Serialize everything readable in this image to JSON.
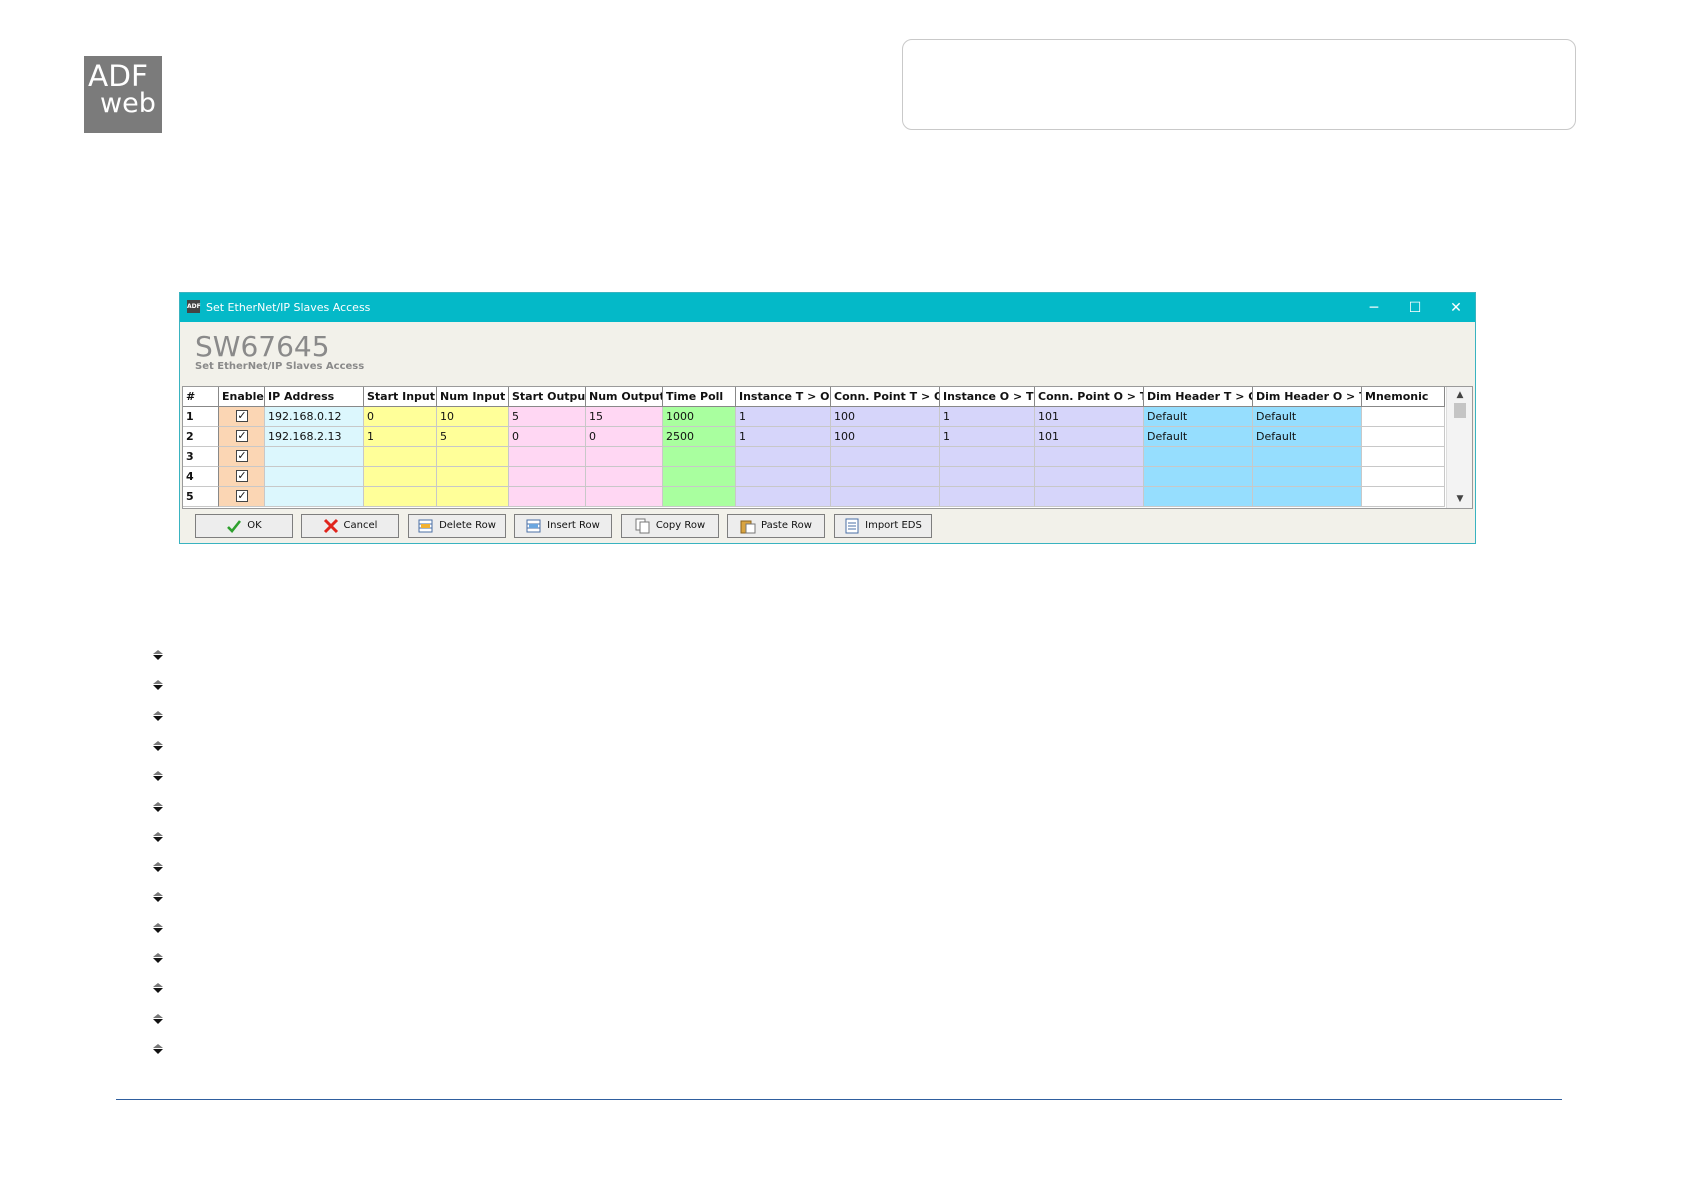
{
  "logo": {
    "line1": "ADF",
    "line2": "web"
  },
  "window": {
    "title": "Set EtherNet/IP Slaves Access",
    "product": "SW67645",
    "subtitle": "Set EtherNet/IP Slaves Access",
    "controls": {
      "minimize": "─",
      "maximize": "☐",
      "close": "✕"
    }
  },
  "columns": [
    "#",
    "Enable",
    "IP Address",
    "Start Input",
    "Num Input",
    "Start Output",
    "Num Output",
    "Time Poll",
    "Instance T > O",
    "Conn. Point T > O",
    "Instance O > T",
    "Conn. Point O > T",
    "Dim Header T > O",
    "Dim Header O > T",
    "Mnemonic"
  ],
  "column_colors": [
    "#ffffff",
    "#fbd6b4",
    "#dcf7fd",
    "#ffff99",
    "#ffff99",
    "#ffd7f3",
    "#ffd7f3",
    "#a9ff9f",
    "#d6d5fa",
    "#d6d5fa",
    "#d6d5fa",
    "#d6d5fa",
    "#96defe",
    "#96defe",
    "#ffffff"
  ],
  "rows": [
    {
      "n": "1",
      "enabled": true,
      "cells": [
        "192.168.0.12",
        "0",
        "10",
        "5",
        "15",
        "1000",
        "1",
        "100",
        "1",
        "101",
        "Default",
        "Default",
        ""
      ]
    },
    {
      "n": "2",
      "enabled": true,
      "cells": [
        "192.168.2.13",
        "1",
        "5",
        "0",
        "0",
        "2500",
        "1",
        "100",
        "1",
        "101",
        "Default",
        "Default",
        ""
      ]
    },
    {
      "n": "3",
      "enabled": true,
      "cells": [
        "",
        "",
        "",
        "",
        "",
        "",
        "",
        "",
        "",
        "",
        "",
        "",
        ""
      ]
    },
    {
      "n": "4",
      "enabled": true,
      "cells": [
        "",
        "",
        "",
        "",
        "",
        "",
        "",
        "",
        "",
        "",
        "",
        "",
        ""
      ]
    },
    {
      "n": "5",
      "enabled": true,
      "cells": [
        "",
        "",
        "",
        "",
        "",
        "",
        "",
        "",
        "",
        "",
        "",
        "",
        ""
      ]
    }
  ],
  "scroll": {
    "up": "▲",
    "down": "▼"
  },
  "buttons": {
    "ok": "OK",
    "cancel": "Cancel",
    "delete_row": "Delete Row",
    "insert_row": "Insert Row",
    "copy_row": "Copy Row",
    "paste_row": "Paste Row",
    "import_eds": "Import EDS"
  },
  "icons": [
    "checkmark-icon",
    "red-x-icon",
    "delete-row-icon",
    "insert-row-icon",
    "copy-row-icon",
    "paste-row-icon",
    "import-eds-icon",
    "bullet-arrow-icon"
  ],
  "colors": {
    "titlebar": "#04b9c8",
    "rule": "#2f5e9e"
  }
}
